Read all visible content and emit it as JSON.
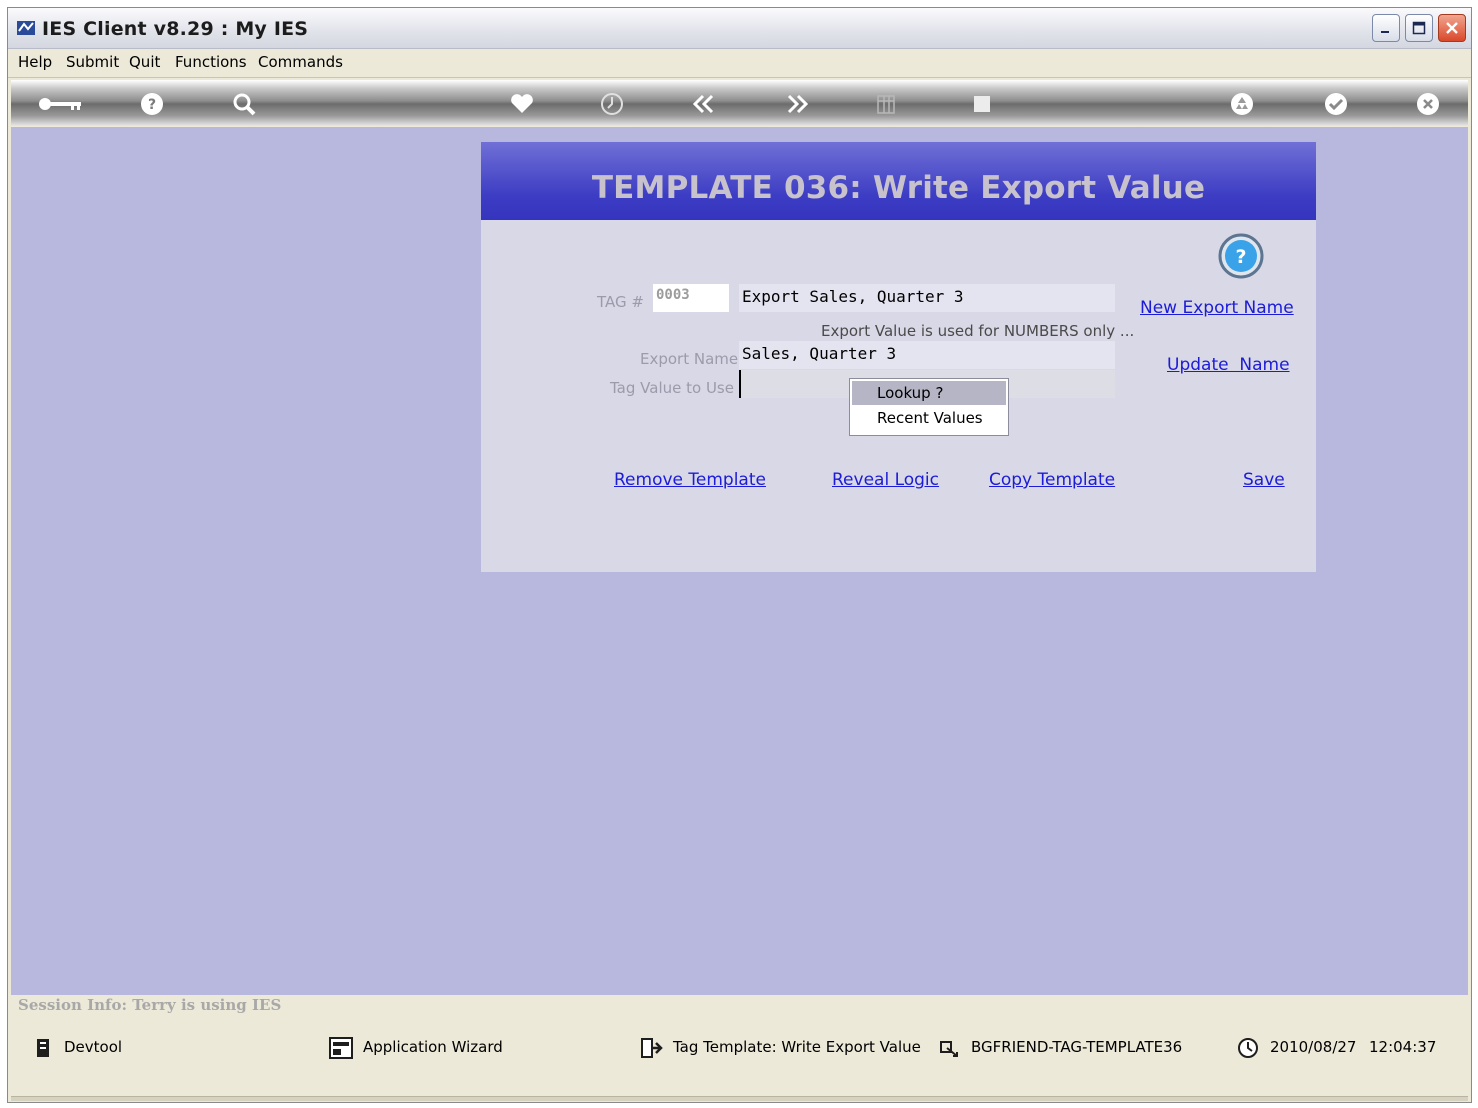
{
  "window": {
    "title": "IES Client v8.29 : My IES",
    "controls": [
      "minimize",
      "maximize",
      "close"
    ]
  },
  "menu": {
    "items": [
      "Help",
      "Submit",
      "Quit",
      "Functions",
      "Commands"
    ]
  },
  "toolbar": {
    "icons": [
      "key-icon",
      "help-icon",
      "search-icon",
      "heart-icon",
      "clock-icon",
      "rewind-icon",
      "forward-icon",
      "grid-icon",
      "stop-icon",
      "recycle-icon",
      "check-icon",
      "close-icon"
    ]
  },
  "panel": {
    "title": "TEMPLATE 036: Write Export Value",
    "tag_label": "TAG #",
    "tag_value": "0003",
    "tag_description": "Export Sales, Quarter 3",
    "note": "Export Value is used for NUMBERS only ...",
    "export_name_label": "Export Name",
    "export_name_value": "Sales, Quarter 3",
    "tag_value_label": "Tag Value to Use",
    "tag_value_input": "",
    "links": {
      "new_export_name": "New Export Name",
      "update_name": "Update  Name",
      "remove_template": "Remove Template",
      "reveal_logic": "Reveal Logic",
      "copy_template": "Copy Template",
      "save": "Save"
    },
    "popup": {
      "items": [
        "Lookup ?",
        "Recent Values"
      ]
    }
  },
  "session": {
    "info": "Session Info: Terry is using IES"
  },
  "statusbar": {
    "devtool": "Devtool",
    "app_wizard": "Application Wizard",
    "tag_template": "Tag Template: Write Export Value",
    "template_id": "BGFRIEND-TAG-TEMPLATE36",
    "date": "2010/08/27",
    "time": "12:04:37"
  }
}
